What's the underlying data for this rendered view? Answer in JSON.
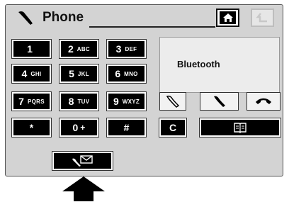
{
  "header": {
    "title": "Phone"
  },
  "keypad": [
    {
      "main": "1",
      "sub": ""
    },
    {
      "main": "2",
      "sub": "ABC"
    },
    {
      "main": "3",
      "sub": "DEF"
    },
    {
      "main": "4",
      "sub": "GHI"
    },
    {
      "main": "5",
      "sub": "JKL"
    },
    {
      "main": "6",
      "sub": "MNO"
    },
    {
      "main": "7",
      "sub": "PQRS"
    },
    {
      "main": "8",
      "sub": "TUV"
    },
    {
      "main": "9",
      "sub": "WXYZ"
    },
    {
      "main": "*",
      "sub": ""
    },
    {
      "main": "0",
      "sub": "+"
    },
    {
      "main": "#",
      "sub": ""
    }
  ],
  "display": {
    "text": "Bluetooth"
  },
  "clear_label": "C",
  "icons": {
    "title": "handset-icon",
    "home": "home-icon",
    "back": "back-arrow-icon",
    "flash": "handset-outline-icon",
    "call": "call-icon",
    "end": "end-call-icon",
    "phonebook": "phonebook-icon",
    "voicemail": "voicemail-icon",
    "pointer": "pointer-arrow"
  }
}
